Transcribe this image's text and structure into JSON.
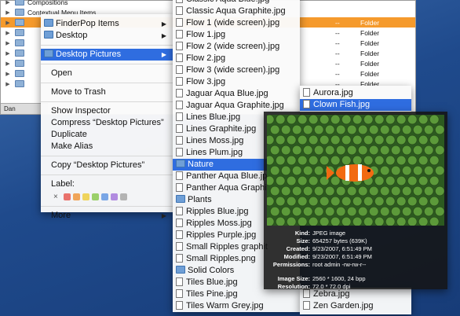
{
  "finder": {
    "rows": [
      {
        "name": "Compositions",
        "dash": "",
        "kind": ""
      },
      {
        "name": "Contextual Menu Items",
        "dash": "",
        "kind": ""
      },
      {
        "name": "",
        "dash": "--",
        "kind": "Folder"
      },
      {
        "name": "",
        "dash": "--",
        "kind": "Folder"
      },
      {
        "name": "",
        "dash": "--",
        "kind": "Folder"
      },
      {
        "name": "",
        "dash": "--",
        "kind": "Folder"
      },
      {
        "name": "",
        "dash": "--",
        "kind": "Folder"
      },
      {
        "name": "",
        "dash": "--",
        "kind": "Folder"
      },
      {
        "name": "",
        "dash": "--",
        "kind": "Folder"
      }
    ],
    "status": "Dan"
  },
  "context_menu": {
    "finderpop": "FinderPop Items",
    "desktop": "Desktop",
    "desktop_pictures": "Desktop Pictures",
    "open": "Open",
    "trash": "Move to Trash",
    "inspector": "Show Inspector",
    "compress": "Compress “Desktop Pictures”",
    "duplicate": "Duplicate",
    "alias": "Make Alias",
    "copy": "Copy “Desktop Pictures”",
    "label": "Label:",
    "label_none": "×",
    "more": "More",
    "label_colors": [
      "#e9726c",
      "#f0a55a",
      "#efd45c",
      "#9bd06a",
      "#79a6e6",
      "#b18be0",
      "#b3b3b3"
    ]
  },
  "files": [
    {
      "name": "Classic Aqua Blue.jpg",
      "type": "doc"
    },
    {
      "name": "Classic Aqua Graphite.jpg",
      "type": "doc"
    },
    {
      "name": "Flow 1 (wide screen).jpg",
      "type": "doc"
    },
    {
      "name": "Flow 1.jpg",
      "type": "doc"
    },
    {
      "name": "Flow 2 (wide screen).jpg",
      "type": "doc"
    },
    {
      "name": "Flow 2.jpg",
      "type": "doc"
    },
    {
      "name": "Flow 3 (wide screen).jpg",
      "type": "doc"
    },
    {
      "name": "Flow 3.jpg",
      "type": "doc"
    },
    {
      "name": "Jaguar Aqua Blue.jpg",
      "type": "doc"
    },
    {
      "name": "Jaguar Aqua Graphite.jpg",
      "type": "doc"
    },
    {
      "name": "Lines Blue.jpg",
      "type": "doc"
    },
    {
      "name": "Lines Graphite.jpg",
      "type": "doc"
    },
    {
      "name": "Lines Moss.jpg",
      "type": "doc"
    },
    {
      "name": "Lines Plum.jpg",
      "type": "doc"
    },
    {
      "name": "Nature",
      "type": "folder",
      "highlight": true
    },
    {
      "name": "Panther Aqua Blue.jpg",
      "type": "doc"
    },
    {
      "name": "Panther Aqua Graphite",
      "type": "doc"
    },
    {
      "name": "Plants",
      "type": "folder"
    },
    {
      "name": "Ripples Blue.jpg",
      "type": "doc"
    },
    {
      "name": "Ripples Moss.jpg",
      "type": "doc"
    },
    {
      "name": "Ripples Purple.jpg",
      "type": "doc"
    },
    {
      "name": "Small Ripples graphit",
      "type": "doc"
    },
    {
      "name": "Small Ripples.png",
      "type": "doc"
    },
    {
      "name": "Solid Colors",
      "type": "folder"
    },
    {
      "name": "Tiles Blue.jpg",
      "type": "doc"
    },
    {
      "name": "Tiles Pine.jpg",
      "type": "doc"
    },
    {
      "name": "Tiles Warm Grey.jpg",
      "type": "doc"
    }
  ],
  "nature": {
    "aurora": "Aurora.jpg",
    "clown": "Clown Fish.jpg",
    "zebra": "Zebra.jpg",
    "zen": "Zen Garden.jpg"
  },
  "info": {
    "kind_k": "Kind:",
    "kind_v": "JPEG image",
    "size_k": "Size:",
    "size_v": "654257 bytes (639K)",
    "created_k": "Created:",
    "created_v": "9/23/2007, 6:51:49 PM",
    "modified_k": "Modified:",
    "modified_v": "9/23/2007, 6:51:49 PM",
    "perm_k": "Permissions:",
    "perm_v": "root admin -rw-rw-r--",
    "imgsize_k": "Image Size:",
    "imgsize_v": "2560 * 1600, 24 bpp",
    "res_k": "Resolution:",
    "res_v": "72.0 * 72.0 dpi"
  }
}
